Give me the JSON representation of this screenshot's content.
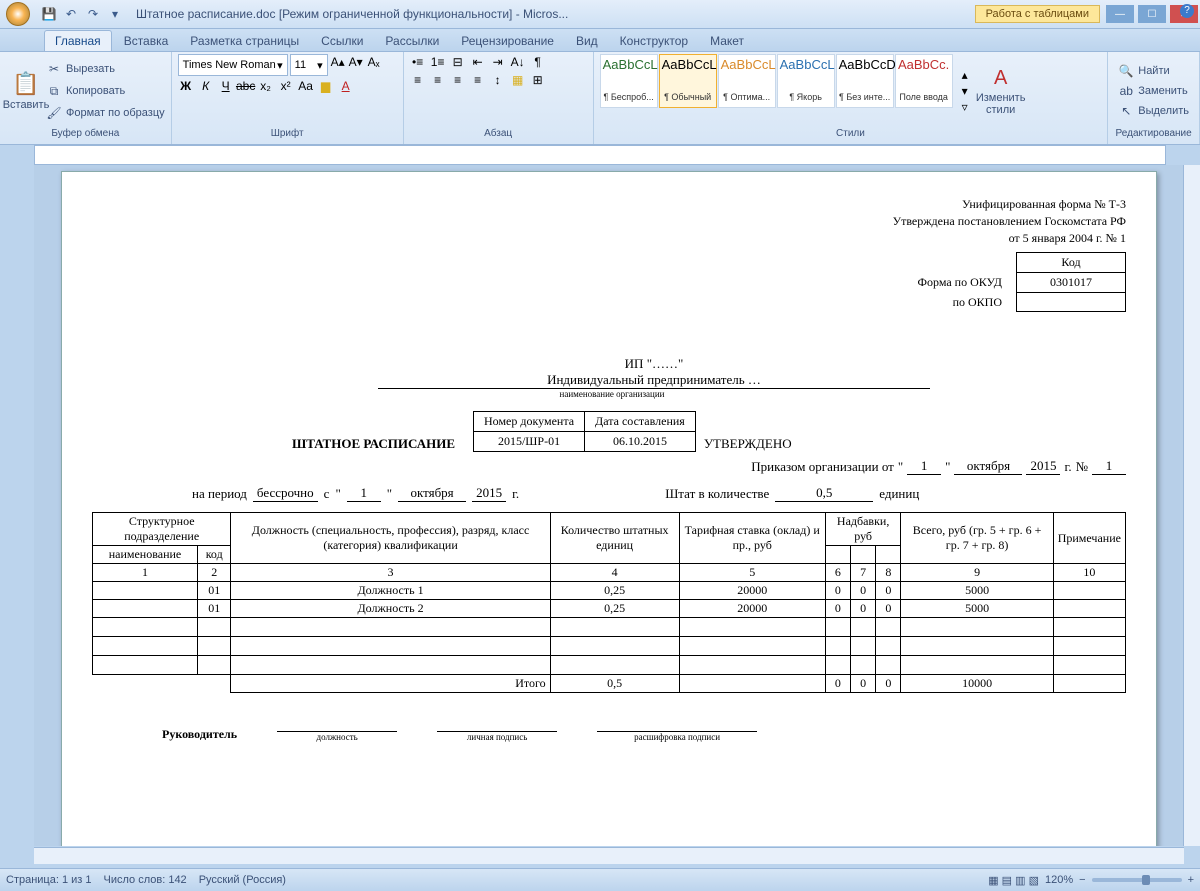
{
  "title": "Штатное расписание.doc [Режим ограниченной функциональности] - Micros...",
  "table_tools": "Работа с таблицами",
  "tabs": [
    "Главная",
    "Вставка",
    "Разметка страницы",
    "Ссылки",
    "Рассылки",
    "Рецензирование",
    "Вид",
    "Конструктор",
    "Макет"
  ],
  "ribbon": {
    "paste": "Вставить",
    "cut": "Вырезать",
    "copy": "Копировать",
    "format_painter": "Формат по образцу",
    "clipboard": "Буфер обмена",
    "font_name": "Times New Roman",
    "font_size": "11",
    "font_group": "Шрифт",
    "para_group": "Абзац",
    "styles_group": "Стили",
    "change_styles": "Изменить стили",
    "edit_group": "Редактирование",
    "find": "Найти",
    "replace": "Заменить",
    "select": "Выделить",
    "styles": [
      {
        "sample": "AaBbCcL",
        "name": "¶ Беспроб...",
        "color": "#2a7030"
      },
      {
        "sample": "AaBbCcL",
        "name": "¶ Обычный",
        "color": "#000",
        "sel": true
      },
      {
        "sample": "AaBbCcL",
        "name": "¶ Оптима...",
        "color": "#d98a2a"
      },
      {
        "sample": "AaBbCcL",
        "name": "¶ Якорь",
        "color": "#2a70b0"
      },
      {
        "sample": "AaBbCcDc",
        "name": "¶ Без инте...",
        "color": "#000"
      },
      {
        "sample": "AaBbCc.",
        "name": "Поле ввода",
        "color": "#c03030"
      }
    ]
  },
  "doc": {
    "form_line1": "Унифицированная форма № Т-3",
    "form_line2": "Утверждена постановлением Госкомстата РФ",
    "form_line3": "от 5 января 2004 г. № 1",
    "code_hdr": "Код",
    "okud_lbl": "Форма по ОКУД",
    "okud": "0301017",
    "okpo_lbl": "по ОКПО",
    "okpo": "",
    "ip": "ИП \"……\"",
    "org": "Индивидуальный предприниматель …",
    "org_sub": "наименование организации",
    "title": "ШТАТНОЕ РАСПИСАНИЕ",
    "no_hdr": "Номер документа",
    "date_hdr": "Дата составления",
    "no": "2015/ШР-01",
    "date": "06.10.2015",
    "approved": "УТВЕРЖДЕНО",
    "order_txt": "Приказом организации от",
    "ord_day": "1",
    "ord_month": "октября",
    "ord_year": "2015",
    "ord_g": "г.",
    "ord_no_lbl": "№",
    "ord_no": "1",
    "period_lbl": "на период",
    "period_val": "бессрочно",
    "period_s": "с",
    "p_day": "1",
    "p_month": "октября",
    "p_year": "2015",
    "p_g": "г.",
    "staff_lbl": "Штат в количестве",
    "staff_qty": "0,5",
    "staff_unit": "единиц",
    "cols": {
      "struct": "Структурное подразделение",
      "name": "наименование",
      "code": "код",
      "pos": "Должность (специальность, профессия), разряд, класс (категория) квалификации",
      "qty": "Количество штатных единиц",
      "rate": "Тарифная ставка (оклад) и пр., руб",
      "allow": "Надбавки, руб",
      "total": "Всего, руб (гр. 5 + гр. 6 + гр. 7 + гр. 8)",
      "note": "Примечание"
    },
    "nums": [
      "1",
      "2",
      "3",
      "4",
      "5",
      "6",
      "7",
      "8",
      "9",
      "10"
    ],
    "rows": [
      {
        "code": "01",
        "pos": "Должность 1",
        "qty": "0,25",
        "rate": "20000",
        "a1": "0",
        "a2": "0",
        "a3": "0",
        "total": "5000"
      },
      {
        "code": "01",
        "pos": "Должность 2",
        "qty": "0,25",
        "rate": "20000",
        "a1": "0",
        "a2": "0",
        "a3": "0",
        "total": "5000"
      }
    ],
    "itogo": "Итого",
    "it_qty": "0,5",
    "it_a1": "0",
    "it_a2": "0",
    "it_a3": "0",
    "it_total": "10000",
    "boss": "Руководитель",
    "sig1": "должность",
    "sig2": "личная подпись",
    "sig3": "расшифровка подписи"
  },
  "status": {
    "page": "Страница: 1 из 1",
    "words": "Число слов: 142",
    "lang": "Русский (Россия)",
    "zoom": "120%"
  }
}
